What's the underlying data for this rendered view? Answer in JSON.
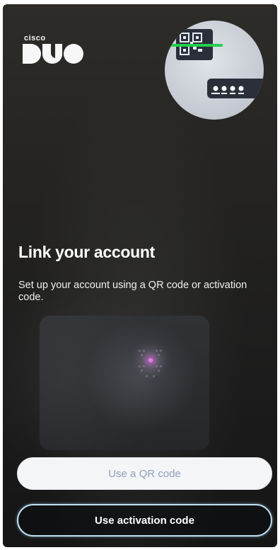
{
  "brand": {
    "company": "cisco",
    "product": "DUO"
  },
  "illustration": {
    "name": "qr-scan-and-code-illustration",
    "scan_line_color": "#22d14a",
    "code_mask": "••••"
  },
  "main": {
    "title": "Link your account",
    "subtitle": "Set up your account using a QR code or activation code."
  },
  "actions": {
    "qr_button_label": "Use a QR code",
    "activation_button_label": "Use activation code"
  },
  "colors": {
    "background": "#1e1e1e",
    "qr_button_bg": "#f4f5f7",
    "qr_button_text": "#8fa0b8",
    "activation_border": "#bfe0f2",
    "accent_dot": "#d36bd8"
  }
}
